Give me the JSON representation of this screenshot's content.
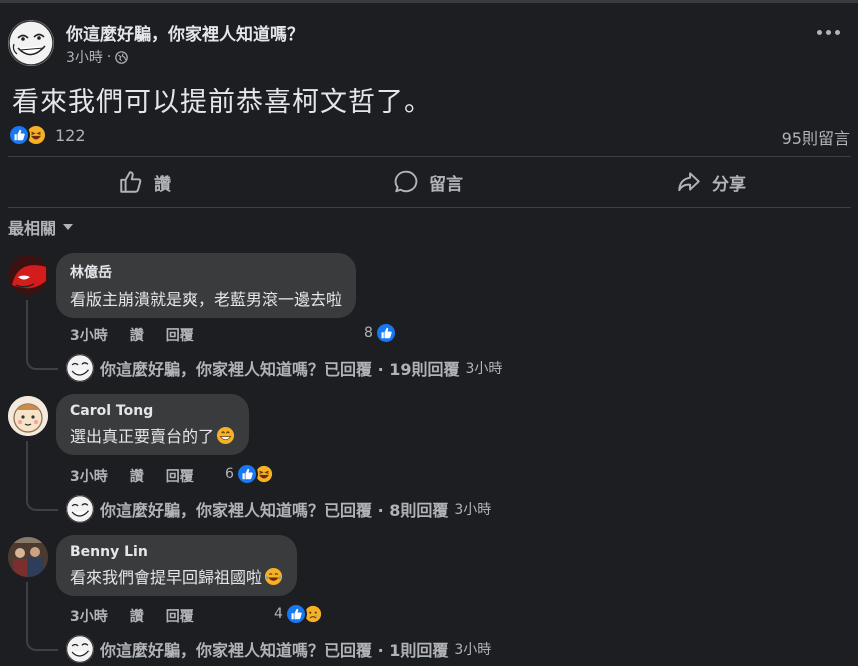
{
  "post": {
    "author": "你這麼好騙，你家裡人知道嗎？",
    "time": "3小時",
    "text": "看來我們可以提前恭喜柯文哲了。",
    "reaction_count": "122",
    "comment_count": "95則留言"
  },
  "actions": {
    "like": "讚",
    "comment": "留言",
    "share": "分享"
  },
  "sort_label": "最相關",
  "comments": [
    {
      "author": "林億岳",
      "text": "看版主崩潰就是爽，老藍男滾一邊去啦",
      "time": "3小時",
      "like": "讚",
      "reply": "回覆",
      "reactions": "8",
      "replied_label": "你這麼好騙，你家裡人知道嗎？已回覆 · 19則回覆",
      "replied_time": "3小時"
    },
    {
      "author": "Carol Tong",
      "text": "選出真正要賣台的了",
      "time": "3小時",
      "like": "讚",
      "reply": "回覆",
      "reactions": "6",
      "replied_label": "你這麼好騙，你家裡人知道嗎？已回覆 · 8則回覆",
      "replied_time": "3小時"
    },
    {
      "author": "Benny Lin",
      "text": "看來我們會提早回歸祖國啦",
      "time": "3小時",
      "like": "讚",
      "reply": "回覆",
      "reactions": "4",
      "replied_label": "你這麼好騙，你家裡人知道嗎？已回覆 · 1則回覆",
      "replied_time": "3小時"
    }
  ],
  "colors": {
    "background": "#1c1e21",
    "bubble": "#3a3b3c",
    "primary_text": "#e4e6eb",
    "secondary_text": "#b0b3b8",
    "like_blue": "#1877f2",
    "emoji_yellow": "#f7b125"
  },
  "icons": [
    "more-options-icon",
    "globe-icon",
    "like-reaction-icon",
    "haha-reaction-icon",
    "sad-reaction-icon",
    "thumbs-up-icon",
    "comment-bubble-icon",
    "share-arrow-icon",
    "dropdown-caret-icon",
    "grinning-emoji-icon",
    "laughing-tears-emoji-icon"
  ]
}
